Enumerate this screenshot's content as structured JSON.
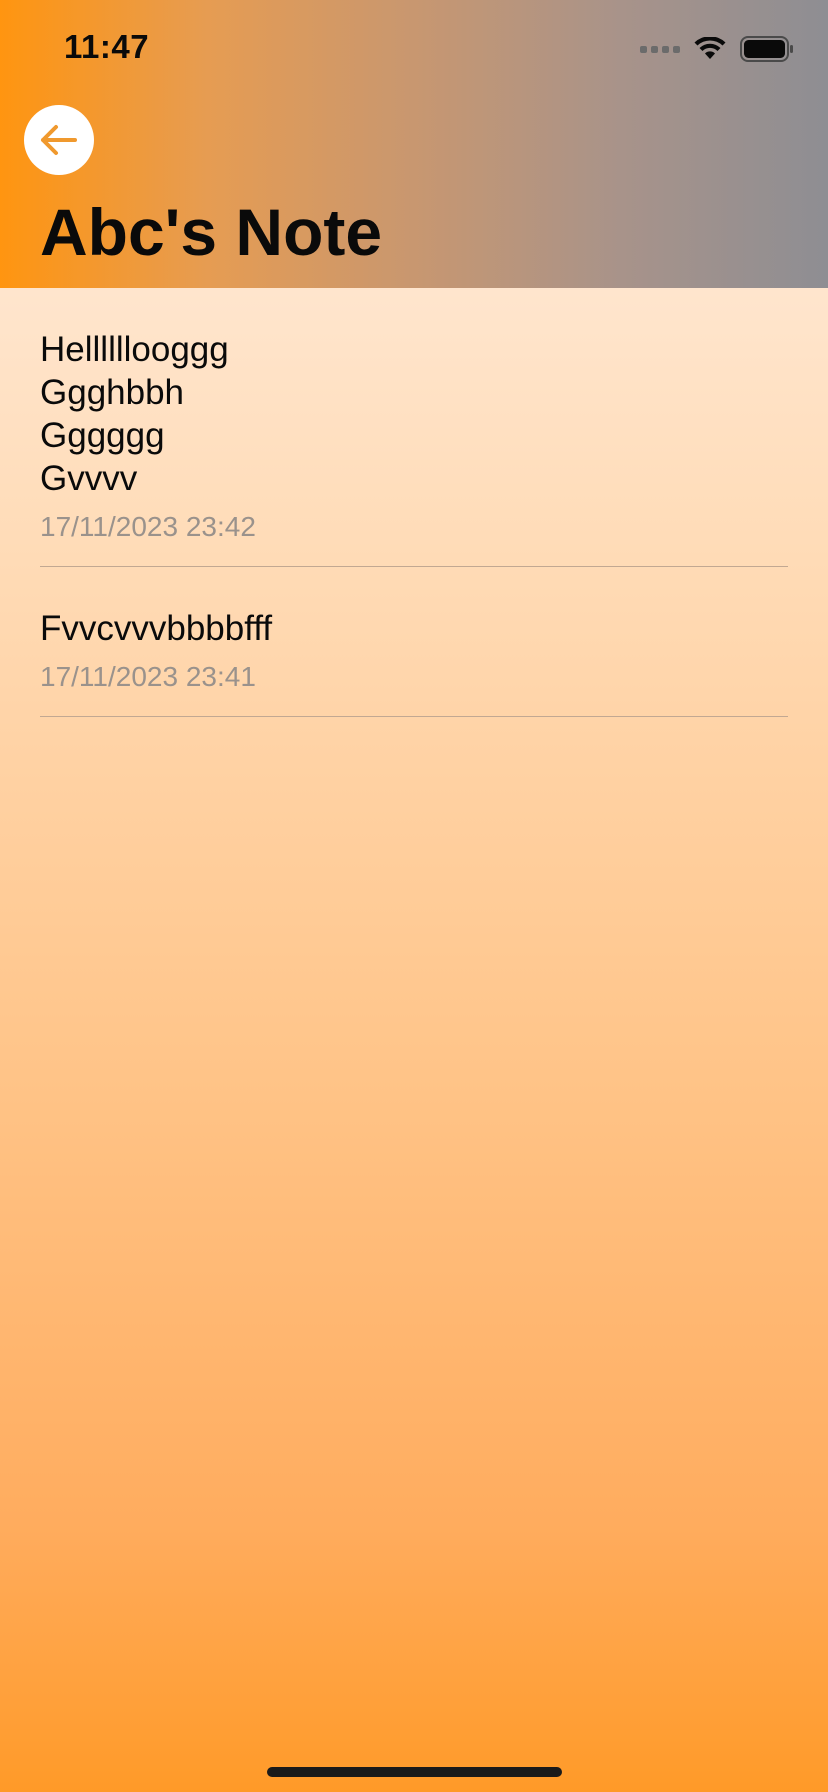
{
  "status_bar": {
    "time": "11:47"
  },
  "header": {
    "title": "Abc's Note",
    "back_icon": "arrow-left-icon",
    "gradient_start": "#ff9510",
    "gradient_end": "#8e8e93"
  },
  "notes": [
    {
      "text": "Hellllllooggg\nGgghbbh\nGggggg\nGvvvv",
      "date": "17/11/2023 23:42"
    },
    {
      "text": "Fvvcvvvbbbbfff",
      "date": "17/11/2023 23:41"
    }
  ],
  "colors": {
    "accent": "#f0992e",
    "date_text": "#9a928c"
  }
}
